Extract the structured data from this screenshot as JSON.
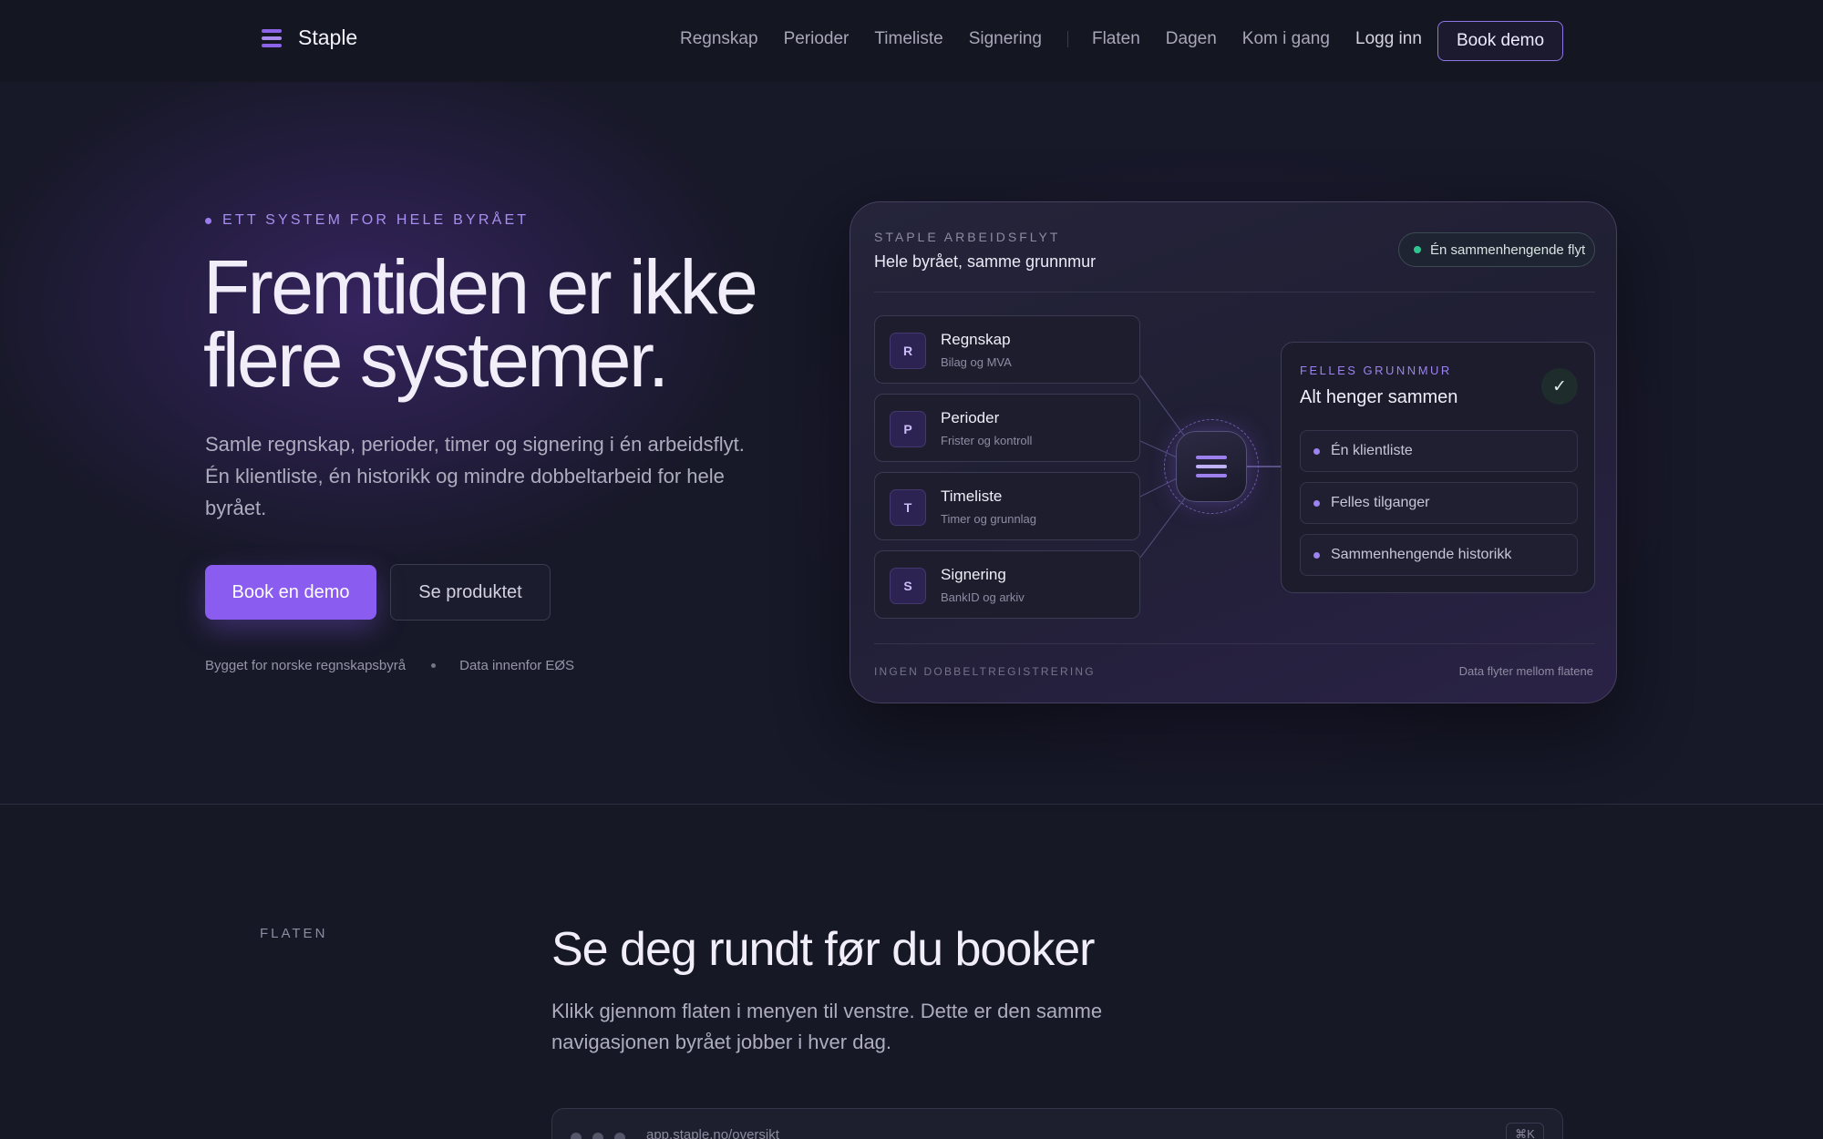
{
  "nav": {
    "brand": "Staple",
    "links": [
      "Regnskap",
      "Perioder",
      "Timeliste",
      "Signering"
    ],
    "links2": [
      "Flaten",
      "Dagen",
      "Kom i gang"
    ],
    "login": "Logg inn",
    "cta": "Book demo"
  },
  "hero": {
    "eyebrow": "ETT SYSTEM FOR HELE BYRÅET",
    "title": "Fremtiden er ikke flere systemer.",
    "description": "Samle regnskap, perioder, timer og signering i én arbeidsflyt. Én klientliste, én historikk og mindre dobbeltarbeid for hele byrået.",
    "primary_cta": "Book en demo",
    "secondary_cta": "Se produktet",
    "trust": [
      "Bygget for norske regnskapsbyrå",
      "Data innenfor EØS"
    ]
  },
  "workflow": {
    "eyebrow": "STAPLE ARBEIDSFLYT",
    "title": "Hele byrået, samme grunnmur",
    "pill": "Én sammenhengende flyt",
    "modules": [
      {
        "badge": "R",
        "name": "Regnskap",
        "sub": "Bilag og MVA"
      },
      {
        "badge": "P",
        "name": "Perioder",
        "sub": "Frister og kontroll"
      },
      {
        "badge": "T",
        "name": "Timeliste",
        "sub": "Timer og grunnlag"
      },
      {
        "badge": "S",
        "name": "Signering",
        "sub": "BankID og arkiv"
      }
    ],
    "panel": {
      "eyebrow": "FELLES GRUNNMUR",
      "title": "Alt henger sammen",
      "check": "✓",
      "items": [
        "Én klientliste",
        "Felles tilganger",
        "Sammenhengende historikk"
      ]
    },
    "footer_left": "INGEN DOBBELTREGISTRERING",
    "footer_right": "Data flyter mellom flatene"
  },
  "section2": {
    "label": "FLATEN",
    "title": "Se deg rundt før du booker",
    "description": "Klikk gjennom flaten i menyen til venstre. Dette er den samme navigasjonen byrået jobber i hver dag.",
    "url": "app.staple.no/oversikt",
    "shortcut": "⌘K"
  }
}
